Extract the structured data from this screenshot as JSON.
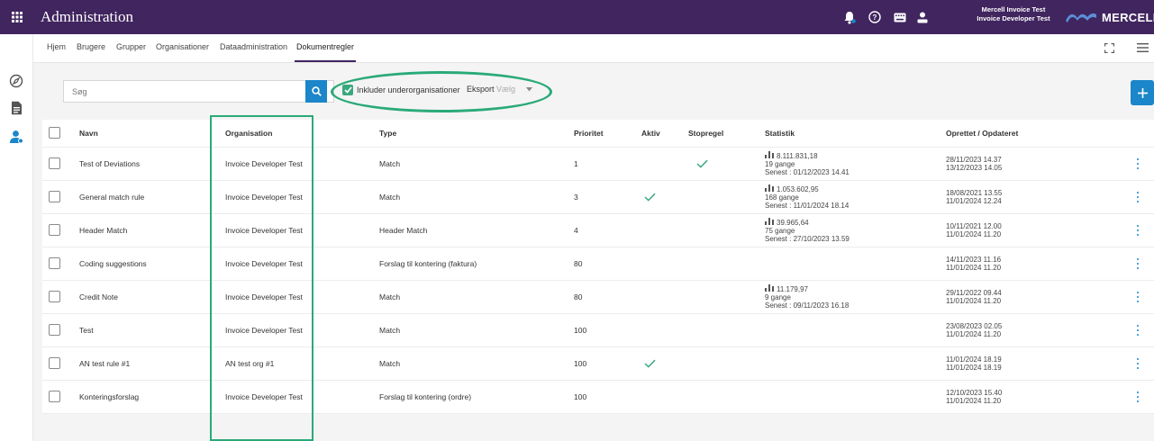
{
  "app": {
    "title": "Administration",
    "brand": "MERCELL",
    "accent": "#40255f",
    "primary": "#1b86c9",
    "check_color": "#3aa87f",
    "annotation_color": "#2aaa78"
  },
  "user": {
    "line1": "Mercell Invoice Test",
    "line2": "Invoice Developer Test"
  },
  "tabs": [
    {
      "label": "Hjem",
      "active": false
    },
    {
      "label": "Brugere",
      "active": false
    },
    {
      "label": "Grupper",
      "active": false
    },
    {
      "label": "Organisationer",
      "active": false
    },
    {
      "label": "Dataadministration",
      "active": false
    },
    {
      "label": "Dokumentregler",
      "active": true
    }
  ],
  "toolbar": {
    "search_placeholder": "Søg",
    "include_label": "Inkluder underorganisationer",
    "include_checked": true,
    "export_label": "Eksport",
    "export_placeholder": "Vælg"
  },
  "table": {
    "columns": [
      "Navn",
      "Organisation",
      "Type",
      "Prioritet",
      "Aktiv",
      "Stopregel",
      "Statistik",
      "Oprettet / Opdateret"
    ],
    "rows": [
      {
        "name": "Test of Deviations",
        "org": "Invoice Developer Test",
        "type": "Match",
        "priority": "1",
        "active": false,
        "stop": true,
        "stat_value": "8.111.831,18",
        "stat_count": "19 gange",
        "stat_last": "Senest : 01/12/2023 14.41",
        "created": "28/11/2023 14.37",
        "updated": "13/12/2023 14.05"
      },
      {
        "name": "General match rule",
        "org": "Invoice Developer Test",
        "type": "Match",
        "priority": "3",
        "active": true,
        "stop": false,
        "stat_value": "1.053.602,95",
        "stat_count": "168 gange",
        "stat_last": "Senest : 11/01/2024 18.14",
        "created": "18/08/2021 13.55",
        "updated": "11/01/2024 12.24"
      },
      {
        "name": "Header Match",
        "org": "Invoice Developer Test",
        "type": "Header Match",
        "priority": "4",
        "active": false,
        "stop": false,
        "stat_value": "39.965,64",
        "stat_count": "75 gange",
        "stat_last": "Senest : 27/10/2023 13.59",
        "created": "10/11/2021 12.00",
        "updated": "11/01/2024 11.20"
      },
      {
        "name": "Coding suggestions",
        "org": "Invoice Developer Test",
        "type": "Forslag til kontering (faktura)",
        "priority": "80",
        "active": false,
        "stop": false,
        "stat_value": "",
        "stat_count": "",
        "stat_last": "",
        "created": "14/11/2023 11.16",
        "updated": "11/01/2024 11.20"
      },
      {
        "name": "Credit Note",
        "org": "Invoice Developer Test",
        "type": "Match",
        "priority": "80",
        "active": false,
        "stop": false,
        "stat_value": "11.179,97",
        "stat_count": "9 gange",
        "stat_last": "Senest : 09/11/2023 16.18",
        "created": "29/11/2022 09.44",
        "updated": "11/01/2024 11.20"
      },
      {
        "name": "Test",
        "org": "Invoice Developer Test",
        "type": "Match",
        "priority": "100",
        "active": false,
        "stop": false,
        "stat_value": "",
        "stat_count": "",
        "stat_last": "",
        "created": "23/08/2023 02.05",
        "updated": "11/01/2024 11.20"
      },
      {
        "name": "AN test rule #1",
        "org": "AN test org #1",
        "type": "Match",
        "priority": "100",
        "active": true,
        "stop": false,
        "stat_value": "",
        "stat_count": "",
        "stat_last": "",
        "created": "11/01/2024 18.19",
        "updated": "11/01/2024 18.19"
      },
      {
        "name": "Konteringsforslag",
        "org": "Invoice Developer Test",
        "type": "Forslag til kontering (ordre)",
        "priority": "100",
        "active": false,
        "stop": false,
        "stat_value": "",
        "stat_count": "",
        "stat_last": "",
        "created": "12/10/2023 15.40",
        "updated": "11/01/2024 11.20"
      }
    ]
  }
}
